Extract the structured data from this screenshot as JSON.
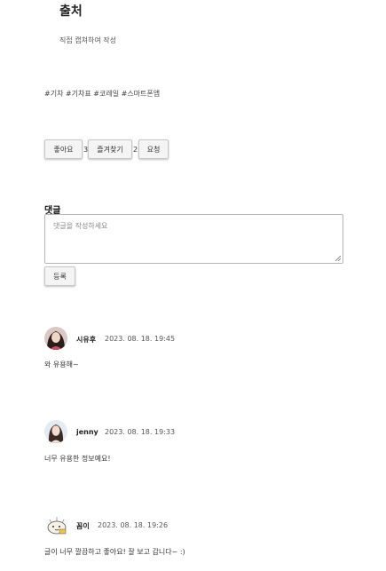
{
  "source": {
    "title": "출처",
    "text": "직접 캡쳐하여 작성"
  },
  "tags": "#기차 #기차표 #코레일 #스마트폰앱",
  "actions": {
    "like_label": "좋아요",
    "like_count": "3",
    "bookmark_label": "즐겨찾기",
    "bookmark_count": "2",
    "summary_label": "요청"
  },
  "comment_form": {
    "heading": "댓글",
    "placeholder": "댓글을 작성하세요",
    "submit_label": "등록"
  },
  "comments": [
    {
      "author": "시유후",
      "date": "2023. 08. 18. 19:45",
      "text": "와 유용해~"
    },
    {
      "author": "jenny",
      "date": "2023. 08. 18. 19:33",
      "text": "너무 유용한 정보예요!"
    },
    {
      "author": "꼼이",
      "date": "2023. 08. 18. 19:26",
      "text": "글이 너무 깔끔하고 좋아요! 잘 보고 갑니다~ :)"
    }
  ]
}
